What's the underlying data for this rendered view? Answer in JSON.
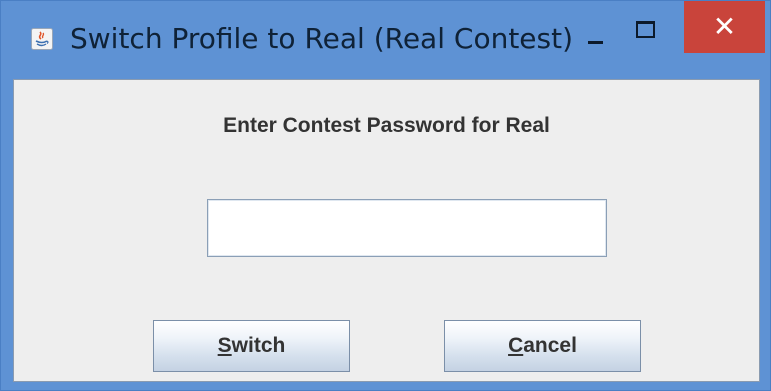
{
  "window": {
    "title": "Switch Profile to Real (Real Contest)",
    "app_icon": "java-icon",
    "controls": {
      "minimize_icon": "minimize-icon",
      "maximize_icon": "maximize-icon",
      "close_icon": "close-icon",
      "close_glyph": "✕",
      "close_color": "#c9443b"
    },
    "frame_color": "#5e92d4"
  },
  "dialog": {
    "prompt": "Enter Contest Password for Real",
    "password": {
      "value": "",
      "placeholder": ""
    },
    "buttons": {
      "switch": {
        "mnemonic": "S",
        "rest": "witch"
      },
      "cancel": {
        "mnemonic": "C",
        "rest": "ancel"
      }
    }
  }
}
